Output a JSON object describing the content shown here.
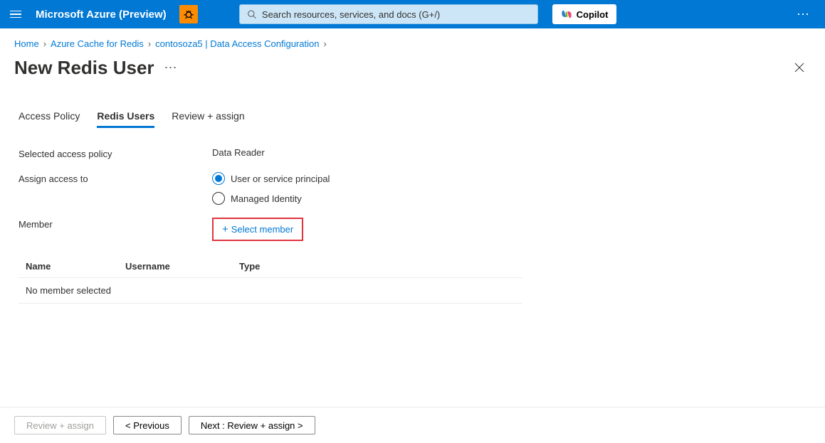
{
  "header": {
    "brand": "Microsoft Azure (Preview)",
    "search_placeholder": "Search resources, services, and docs (G+/)",
    "copilot_label": "Copilot"
  },
  "breadcrumb": {
    "items": [
      "Home",
      "Azure Cache for Redis",
      "contosoza5 | Data Access Configuration"
    ]
  },
  "page": {
    "title": "New Redis User"
  },
  "tabs": [
    {
      "label": "Access Policy",
      "active": false
    },
    {
      "label": "Redis Users",
      "active": true
    },
    {
      "label": "Review + assign",
      "active": false
    }
  ],
  "form": {
    "selected_policy_label": "Selected access policy",
    "selected_policy_value": "Data Reader",
    "assign_access_label": "Assign access to",
    "radio_options": [
      {
        "label": "User or service principal",
        "selected": true
      },
      {
        "label": "Managed Identity",
        "selected": false
      }
    ],
    "member_label": "Member",
    "select_member_button": "Select member"
  },
  "table": {
    "columns": [
      "Name",
      "Username",
      "Type"
    ],
    "empty_message": "No member selected"
  },
  "footer": {
    "review_assign": "Review + assign",
    "previous": "< Previous",
    "next": "Next : Review + assign >"
  }
}
